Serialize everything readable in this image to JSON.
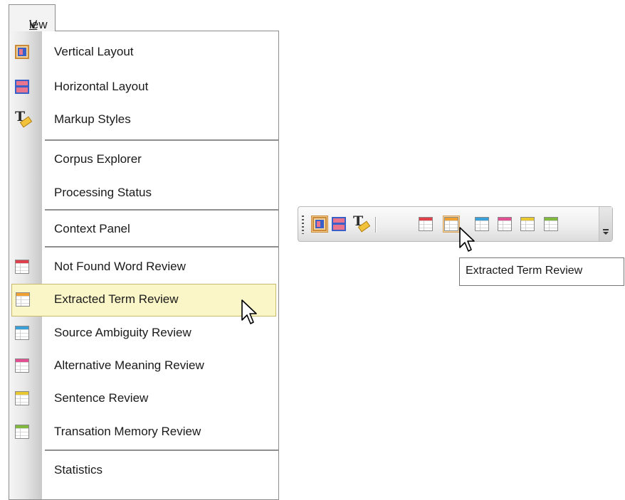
{
  "menu": {
    "title_accel": "V",
    "title_rest": "iew",
    "items": [
      {
        "label": "Vertical Layout",
        "icon": "vertical-layout-icon"
      },
      {
        "label": "Horizontal Layout",
        "icon": "horizontal-layout-icon"
      },
      {
        "label": "Markup Styles",
        "icon": "markup-styles-icon"
      },
      {
        "label": "Corpus Explorer"
      },
      {
        "label": "Processing Status"
      },
      {
        "label": "Context Panel"
      },
      {
        "label": "Not Found Word Review",
        "icon": "table-red-icon"
      },
      {
        "label": "Extracted Term Review",
        "icon": "table-orange-icon",
        "highlighted": true
      },
      {
        "label": "Source Ambiguity Review",
        "icon": "table-blue-icon"
      },
      {
        "label": "Alternative Meaning Review",
        "icon": "table-pink-icon"
      },
      {
        "label": "Sentence Review",
        "icon": "table-yellow-icon"
      },
      {
        "label": "Transation Memory Review",
        "icon": "table-green-icon"
      },
      {
        "label": "Statistics"
      }
    ]
  },
  "toolbar": {
    "buttons": [
      {
        "icon": "vertical-layout-icon",
        "pressed": true
      },
      {
        "icon": "horizontal-layout-icon"
      },
      {
        "icon": "markup-styles-icon"
      },
      {
        "icon": "table-red-icon"
      },
      {
        "icon": "table-orange-icon",
        "hovered": true
      },
      {
        "icon": "table-blue-icon"
      },
      {
        "icon": "table-pink-icon"
      },
      {
        "icon": "table-yellow-icon"
      },
      {
        "icon": "table-green-icon"
      }
    ],
    "tooltip": "Extracted Term Review"
  },
  "colors": {
    "highlight_bg": "#fbf6c8",
    "highlight_border": "#c8b96c",
    "table_red": "#e0404a",
    "table_orange": "#f0a030",
    "table_blue": "#3aa0d8",
    "table_pink": "#e05090",
    "table_yellow": "#e8c830",
    "table_green": "#80b840"
  }
}
